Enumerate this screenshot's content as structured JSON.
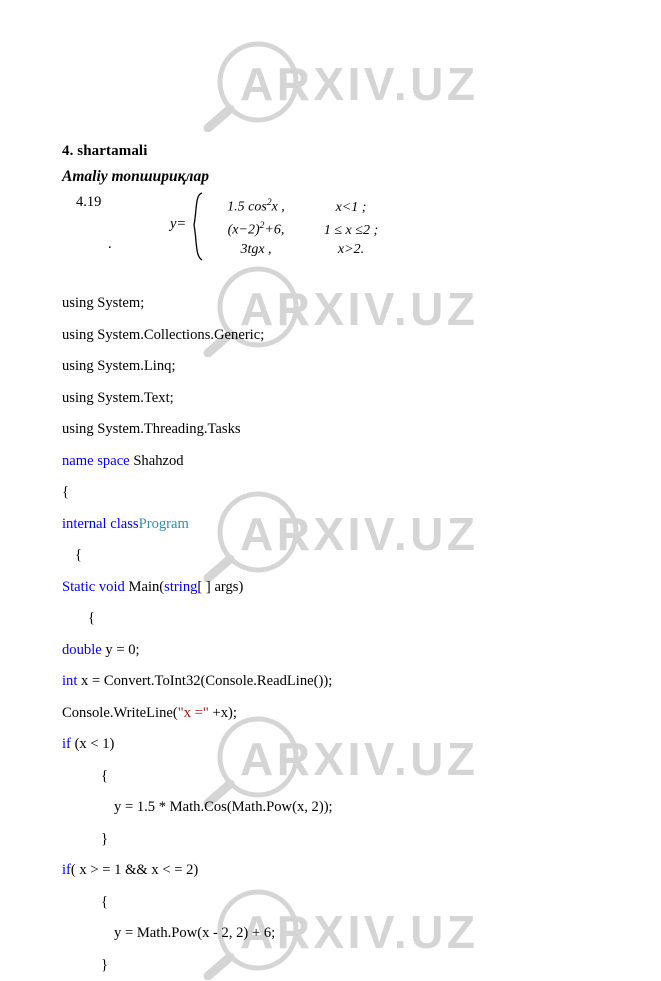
{
  "document": {
    "heading": "4. shartamali",
    "subheading": "Amaliy топшириқлар"
  },
  "exercise": {
    "number": "4.19",
    "trailing_dot": ".",
    "formula": {
      "lhs": "y=",
      "cases": [
        {
          "expr_prefix": "1.5 cos",
          "expr_sup": "2",
          "expr_suffix": "x ,",
          "condition": "x<1 ;"
        },
        {
          "expr_prefix": "(x−2)",
          "expr_sup": "2",
          "expr_suffix": "+6,",
          "condition": "1 ≤ x ≤2 ;"
        },
        {
          "expr_prefix": "3",
          "expr_sup": "",
          "expr_suffix": "tgx ,",
          "condition": "x>2."
        }
      ]
    }
  },
  "code": {
    "language": "csharp",
    "colors": {
      "keyword": "#0000ff",
      "type": "#2b91af",
      "string": "#a31515",
      "text": "#000000"
    },
    "lines": [
      {
        "indent": 0,
        "tokens": [
          {
            "t": "using System;",
            "c": "text"
          }
        ]
      },
      {
        "indent": 0,
        "tokens": [
          {
            "t": "using System.Collections.Generic;",
            "c": "text"
          }
        ]
      },
      {
        "indent": 0,
        "tokens": [
          {
            "t": "using System.Linq;",
            "c": "text"
          }
        ]
      },
      {
        "indent": 0,
        "tokens": [
          {
            "t": "using System.Text;",
            "c": "text"
          }
        ]
      },
      {
        "indent": 0,
        "tokens": [
          {
            "t": "using System.Threading.Tasks",
            "c": "text"
          }
        ]
      },
      {
        "indent": 0,
        "tokens": [
          {
            "t": "name space",
            "c": "keyword"
          },
          {
            "t": " Shahzod",
            "c": "text"
          }
        ]
      },
      {
        "indent": 0,
        "tokens": [
          {
            "t": "{",
            "c": "text"
          }
        ]
      },
      {
        "indent": 0,
        "tokens": [
          {
            "t": "internal class",
            "c": "keyword"
          },
          {
            "t": "Program",
            "c": "type"
          }
        ]
      },
      {
        "indent": 1,
        "tokens": [
          {
            "t": "{",
            "c": "text"
          }
        ]
      },
      {
        "indent": 0,
        "tokens": [
          {
            "t": "Static void",
            "c": "keyword"
          },
          {
            "t": " Main(",
            "c": "text"
          },
          {
            "t": "string",
            "c": "keyword"
          },
          {
            "t": "[ ] args)",
            "c": "text"
          }
        ]
      },
      {
        "indent": 2,
        "tokens": [
          {
            "t": "{",
            "c": "text"
          }
        ]
      },
      {
        "indent": 0,
        "tokens": [
          {
            "t": "double",
            "c": "keyword"
          },
          {
            "t": " y = 0;",
            "c": "text"
          }
        ]
      },
      {
        "indent": 0,
        "tokens": [
          {
            "t": "int",
            "c": "keyword"
          },
          {
            "t": " x = Convert.ToInt32(Console.ReadLine());",
            "c": "text"
          }
        ]
      },
      {
        "indent": 0,
        "tokens": [
          {
            "t": "Console.WriteLine(",
            "c": "text"
          },
          {
            "t": "\"x =\"",
            "c": "string"
          },
          {
            "t": " +x);",
            "c": "text"
          }
        ]
      },
      {
        "indent": 0,
        "tokens": [
          {
            "t": "if",
            "c": "keyword"
          },
          {
            "t": " (x < 1)",
            "c": "text"
          }
        ]
      },
      {
        "indent": 3,
        "tokens": [
          {
            "t": "{",
            "c": "text"
          }
        ]
      },
      {
        "indent": 4,
        "tokens": [
          {
            "t": "y = 1.5 * Math.Cos(Math.Pow(x, 2));",
            "c": "text"
          }
        ]
      },
      {
        "indent": 3,
        "tokens": [
          {
            "t": "}",
            "c": "text"
          }
        ]
      },
      {
        "indent": 0,
        "tokens": [
          {
            "t": "if",
            "c": "keyword"
          },
          {
            "t": "( x > = 1 && x < = 2)",
            "c": "text"
          }
        ]
      },
      {
        "indent": 3,
        "tokens": [
          {
            "t": "{",
            "c": "text"
          }
        ]
      },
      {
        "indent": 4,
        "tokens": [
          {
            "t": "y = Math.Pow(x - 2, 2) + 6;",
            "c": "text"
          }
        ]
      },
      {
        "indent": 3,
        "tokens": [
          {
            "t": "}",
            "c": "text"
          }
        ]
      }
    ]
  },
  "watermark": {
    "text": "ARXIV.UZ",
    "color": "#d5d5d5",
    "positions": [
      40,
      265,
      490,
      715,
      888
    ]
  }
}
